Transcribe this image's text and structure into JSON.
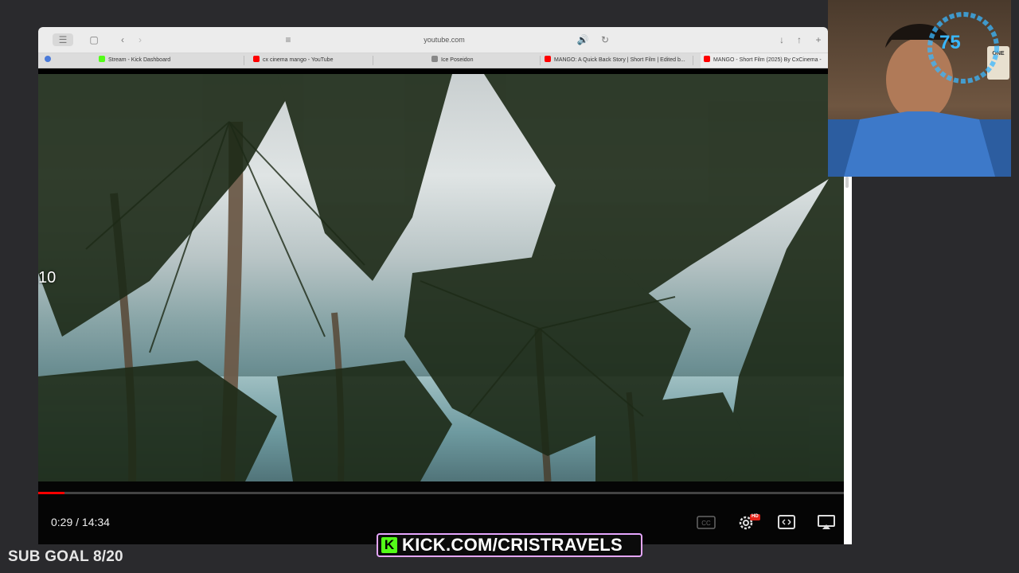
{
  "browser": {
    "url": "youtube.com",
    "tabs": [
      {
        "label": "Stream - Kick Dashboard",
        "favicon": "kick-icon",
        "color": "#53fc18"
      },
      {
        "label": "cx cinema mango - YouTube",
        "favicon": "youtube-icon",
        "color": "#ff0000"
      },
      {
        "label": "Ice Poseidon",
        "favicon": "profile-icon",
        "color": "#888888"
      },
      {
        "label": "MANGO: A Quick Back Story | Short Film | Edited b...",
        "favicon": "youtube-icon",
        "color": "#ff0000"
      },
      {
        "label": "MANGO - Short Film (2025) By CxCinema -",
        "favicon": "youtube-icon",
        "color": "#ff0000"
      }
    ]
  },
  "video": {
    "frame_number": "10",
    "time": "0:29 / 14:34",
    "progress": 0.033,
    "quality_badge": "HD"
  },
  "webcam": {
    "gauge_value": "75",
    "sign_text": "ONE"
  },
  "overlay": {
    "kick_url": "KICK.COM/CRISTRAVELS",
    "kick_letter": "K",
    "sub_goal": "SUB GOAL 8/20"
  },
  "colors": {
    "kick_green": "#53fc18",
    "youtube_red": "#ff0000",
    "gauge_blue": "#39b7ff"
  }
}
